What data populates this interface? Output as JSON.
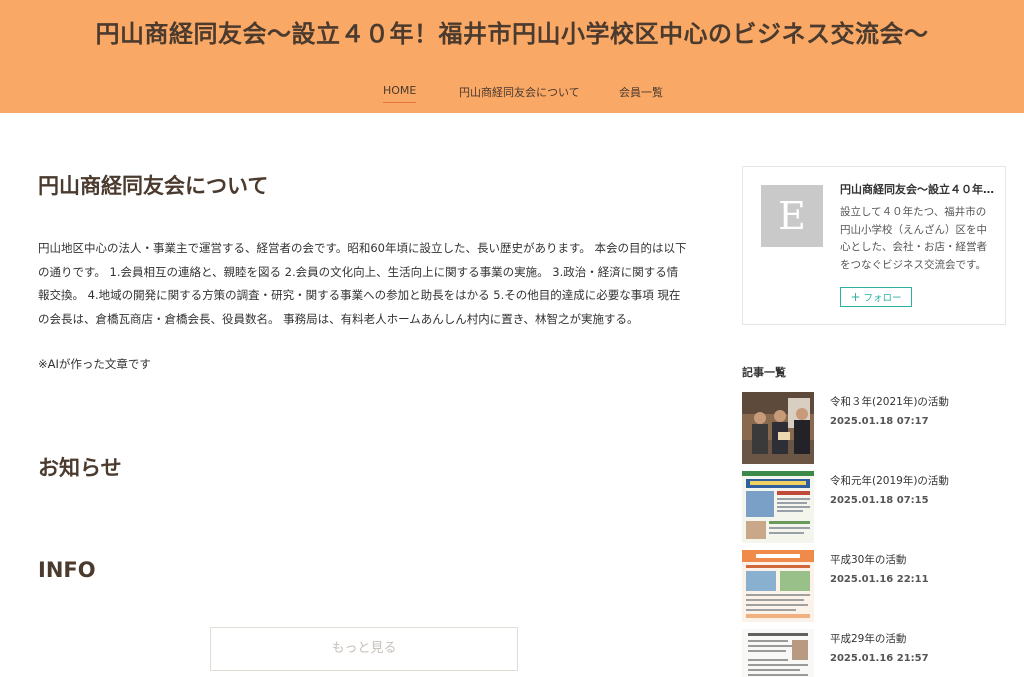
{
  "header": {
    "site_title": "円山商経同友会〜設立４０年！福井市円山小学校区中心のビジネス交流会〜",
    "bg_color": "#f9a865",
    "nav": {
      "home": "HOME",
      "about": "円山商経同友会について",
      "members": "会員一覧"
    }
  },
  "main": {
    "heading": "円山商経同友会について",
    "body": "円山地区中心の法人・事業主で運営する、経営者の会です。昭和60年頃に設立した、長い歴史があります。 本会の目的は以下の通りです。 1.会員相互の連絡と、親睦を図る 2.会員の文化向上、生活向上に関する事業の実施。 3.政治・経済に関する情報交換。 4.地域の開発に関する方策の調査・研究・関する事業への参加と助長をはかる 5.その他目的達成に必要な事項 現在の会長は、倉橋瓦商店・倉橋会長、役員数名。 事務局は、有料老人ホームあんしん村内に置き、林智之が実施する。",
    "note": "※AIが作った文章です",
    "news_heading": "お知らせ",
    "info_heading": "INFO",
    "more_label": "もっと見る"
  },
  "sidebar": {
    "profile": {
      "avatar_letter": "E",
      "name": "円山商経同友会〜設立４０年！福井市円山小学校区中心のビジネス交流会〜",
      "description": "設立して４０年たつ、福井市の円山小学校（えんざん）区を中心とした、会社・お店・経営者をつなぐビジネス交流会です。",
      "follow_label": "フォロー",
      "follow_icon": "plus-icon",
      "accent_color": "#2bb0a3"
    },
    "articles_title": "記事一覧",
    "articles": [
      {
        "title": "令和３年(2021年)の活動",
        "date": "2025.01.18 07:17"
      },
      {
        "title": "令和元年(2019年)の活動",
        "date": "2025.01.18 07:15"
      },
      {
        "title": "平成30年の活動",
        "date": "2025.01.16 22:11"
      },
      {
        "title": "平成29年の活動",
        "date": "2025.01.16 21:57"
      }
    ]
  }
}
